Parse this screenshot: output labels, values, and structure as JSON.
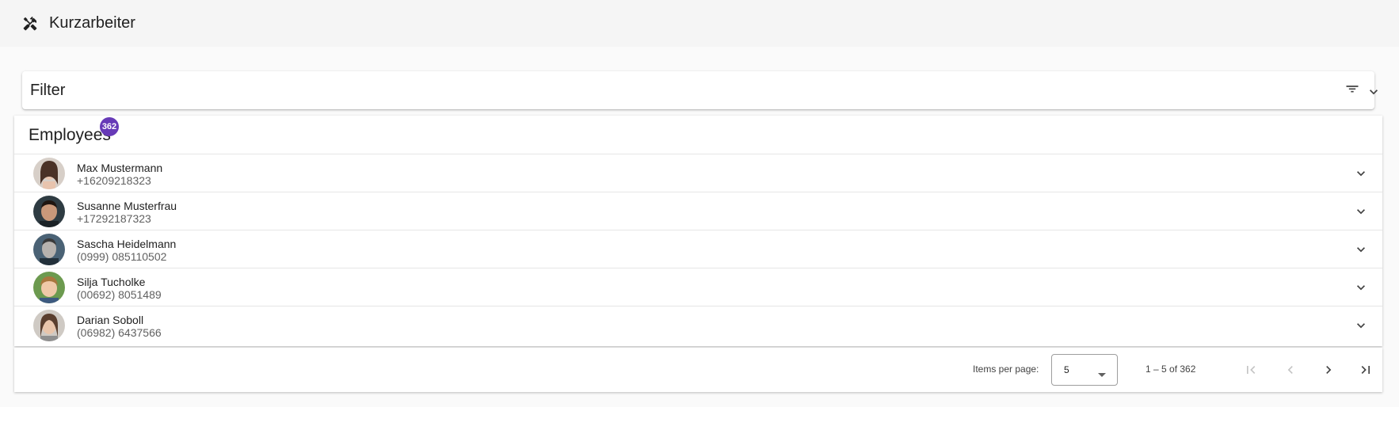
{
  "toolbar": {
    "title": "Kurzarbeiter",
    "icon": "tools-icon"
  },
  "filter": {
    "title": "Filter",
    "icons": [
      "filter-list-icon",
      "chevron-down-icon"
    ]
  },
  "employees": {
    "title": "Employees",
    "count_badge": "362",
    "items": [
      {
        "name": "Max Mustermann",
        "phone": "+16209218323"
      },
      {
        "name": "Susanne Musterfrau",
        "phone": "+17292187323"
      },
      {
        "name": "Sascha Heidelmann",
        "phone": "(0999) 085110502"
      },
      {
        "name": "Silja Tucholke",
        "phone": "(00692) 8051489"
      },
      {
        "name": "Darian Soboll",
        "phone": "(06982) 6437566"
      }
    ]
  },
  "paginator": {
    "items_per_page_label": "Items per page:",
    "items_per_page_value": "5",
    "range_label": "1 – 5 of 362",
    "icons": [
      "first-page-icon",
      "previous-page-icon",
      "next-page-icon",
      "last-page-icon"
    ]
  },
  "colors": {
    "badge": "#673ab7",
    "toolbar_bg": "#f5f5f5",
    "content_bg": "#fafafa"
  }
}
